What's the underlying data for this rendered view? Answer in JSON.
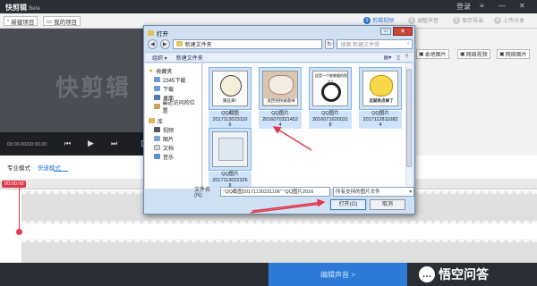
{
  "app": {
    "logo": "快剪辑",
    "logo_suffix": "Beta",
    "login": "登录",
    "win_controls": [
      "≡",
      "—",
      "✕"
    ]
  },
  "toolbar": {
    "new_project": "新建项目",
    "my_projects": "我的项目",
    "steps": [
      {
        "num": "1",
        "label": "剪辑视频",
        "active": true
      },
      {
        "num": "2",
        "label": "调整声音",
        "active": false
      },
      {
        "num": "3",
        "label": "保存导出",
        "active": false
      },
      {
        "num": "4",
        "label": "上传分享",
        "active": false
      }
    ]
  },
  "preview": {
    "watermark": "快剪辑",
    "time": "00:00.00/00:00.00"
  },
  "right_tools": {
    "local_image": "本地图片",
    "online_video": "网络视频",
    "online_image": "网络图片"
  },
  "editor": {
    "pro_mode": "专业模式",
    "fast_mode": "快速模式",
    "timecode": "00:00.00",
    "edit_audio_button": "编辑声音"
  },
  "brand": {
    "text": "悟空问答"
  },
  "dialog": {
    "title": "打开",
    "path": "新建文件夹",
    "search_placeholder": "搜索 新建文件夹",
    "tool_organize": "组织",
    "tool_new_folder": "新建文件夹",
    "nav": {
      "favorites": "收藏夹",
      "fav_items": [
        "2345下载",
        "下载",
        "桌面",
        "最近访问的位置"
      ],
      "library": "库",
      "lib_items": [
        "视频",
        "图片",
        "文档",
        "音乐"
      ]
    },
    "files": [
      {
        "line1": "QQ截图",
        "line2": "2017113023110",
        "line3": "6",
        "caption": "跟这来！",
        "face_color": "#f4f0d8",
        "selected": true
      },
      {
        "line1": "QQ图片",
        "line2": "2016070321452",
        "line3": "4",
        "caption": "滚回拐拐被裁掉",
        "face_color": "#e8d2b8",
        "selected": true
      },
      {
        "line1": "QQ图片",
        "line2": "2016071620031",
        "line3": "8",
        "caption": "这是一个被鲁腿的照片？",
        "face_color": "#f2f2f2",
        "selected": true
      },
      {
        "line1": "QQ图片",
        "line2": "2017112811082",
        "line3": "4",
        "caption": "这就有点掉了",
        "face_color": "#f7d84a",
        "selected": true
      },
      {
        "line1": "QQ图片",
        "line2": "2017113022325",
        "line3": "8",
        "caption": "",
        "face_color": "#eef3f8",
        "selected": true
      }
    ],
    "filename_label": "文件名(N):",
    "filename_value": "\"QQ截图20171130231106\" \"QQ图片2016",
    "filetype": "所有支持的图片文件",
    "open_button": "打开(O)",
    "cancel_button": "取消"
  },
  "accent": {
    "blue": "#2d7bd6",
    "red": "#e0394b"
  }
}
